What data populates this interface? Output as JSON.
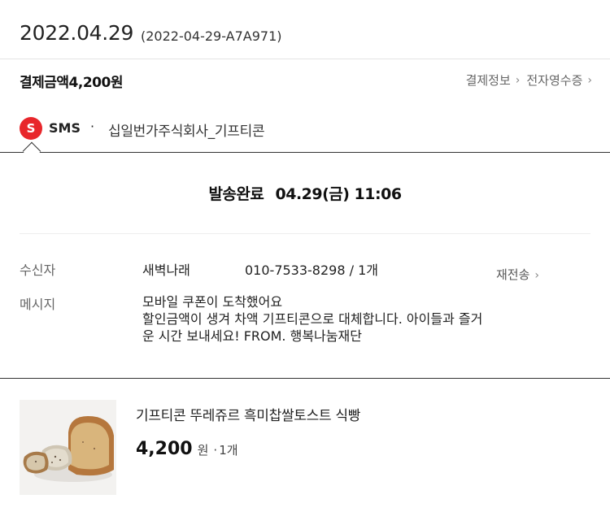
{
  "order": {
    "date": "2022.04.29",
    "id": "(2022-04-29-A7A971)"
  },
  "payment": {
    "label": "결제금액4,200원",
    "links": [
      {
        "label": "결제정보",
        "icon": "chevron-right-icon"
      },
      {
        "label": "전자영수증",
        "icon": "chevron-right-icon"
      }
    ]
  },
  "sms": {
    "badge": "S",
    "badge_color": "#e8262b",
    "type": "SMS",
    "separator": "·",
    "sender": "십일번가주식회사_기프티콘"
  },
  "delivery": {
    "status_label": "발송완료",
    "status_time": "04.29(금) 11:06",
    "recipient_label": "수신자",
    "recipient_name": "새벽나래",
    "recipient_phone": "010-7533-8298 / 1개",
    "resend_label": "재전송",
    "message_label": "메시지",
    "message_lines": [
      "모바일 쿠폰이 도착했어요",
      "할인금액이 생겨 차액 기프티콘으로 대체합니다. 아이들과 즐거",
      "운 시간 보내세요! FROM. 행복나눔재단"
    ]
  },
  "product": {
    "title": "기프티콘 뚜레쥬르 흑미찹쌀토스트 식빵",
    "price": "4,200",
    "unit": "원",
    "separator": "·",
    "quantity": "1개"
  }
}
